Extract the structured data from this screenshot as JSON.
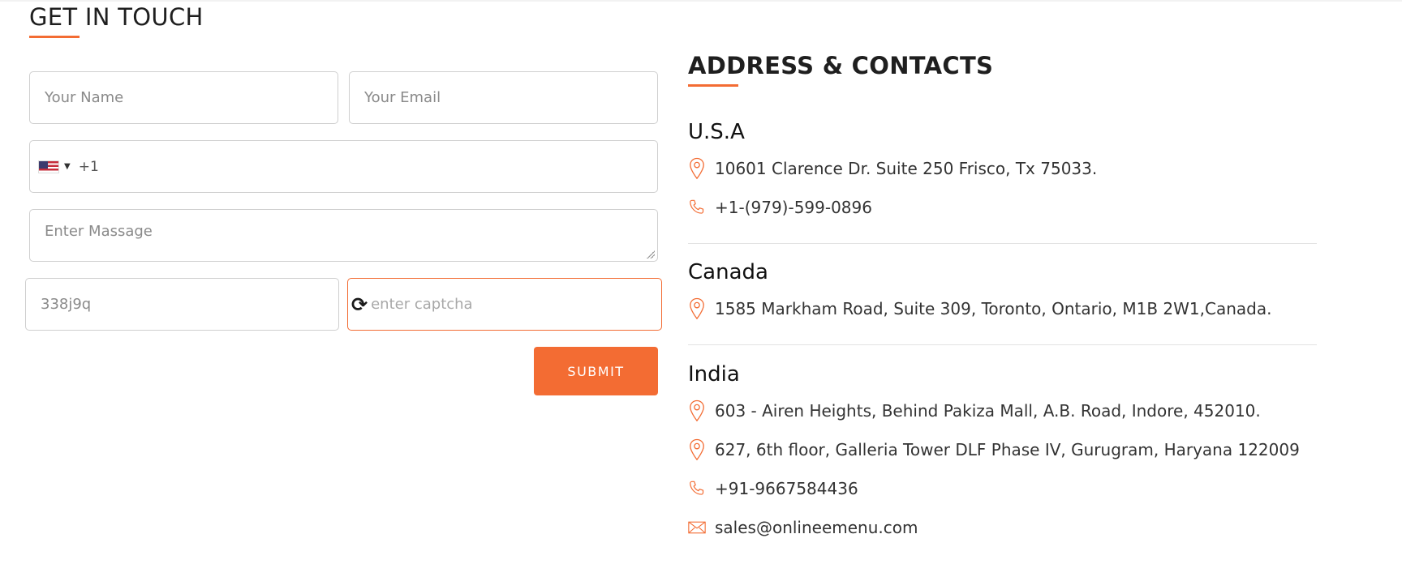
{
  "form": {
    "title": "GET IN TOUCH",
    "name_placeholder": "Your Name",
    "email_placeholder": "Your Email",
    "phone_dial_code": "+1",
    "phone_country_icon": "us-flag-icon",
    "message_placeholder": "Enter Massage",
    "captcha_code": "338j9q",
    "captcha_placeholder": "enter captcha",
    "submit_label": "SUBMIT"
  },
  "contacts": {
    "title": "ADDRESS & CONTACTS",
    "accent_color": "#f36c33",
    "usa": {
      "name": "U.S.A",
      "address": "10601 Clarence Dr. Suite 250 Frisco, Tx 75033.",
      "phone": "+1-(979)-599-0896"
    },
    "canada": {
      "name": "Canada",
      "address": "1585 Markham Road, Suite 309, Toronto, Ontario, M1B 2W1,Canada."
    },
    "india": {
      "name": "India",
      "address_1": "603 - Airen Heights, Behind Pakiza Mall, A.B. Road, Indore, 452010.",
      "address_2": "627, 6th floor, Galleria Tower DLF Phase IV, Gurugram, Haryana 122009",
      "phone": "+91-9667584436",
      "email": "sales@onlineemenu.com"
    }
  }
}
